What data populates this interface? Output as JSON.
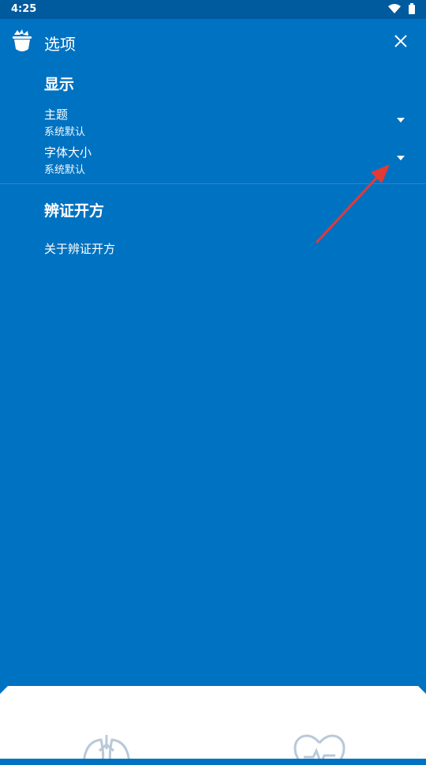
{
  "status_bar": {
    "time": "4:25"
  },
  "header": {
    "title": "选项"
  },
  "sections": {
    "display": {
      "title": "显示",
      "theme": {
        "label": "主题",
        "value": "系统默认"
      },
      "font_size": {
        "label": "字体大小",
        "value": "系统默认"
      }
    },
    "about": {
      "title": "辨证开方",
      "link": "关于辨证开方"
    }
  },
  "colors": {
    "background": "#0072C2",
    "status_bar": "#005A9E",
    "annotation_arrow": "#E53935"
  }
}
